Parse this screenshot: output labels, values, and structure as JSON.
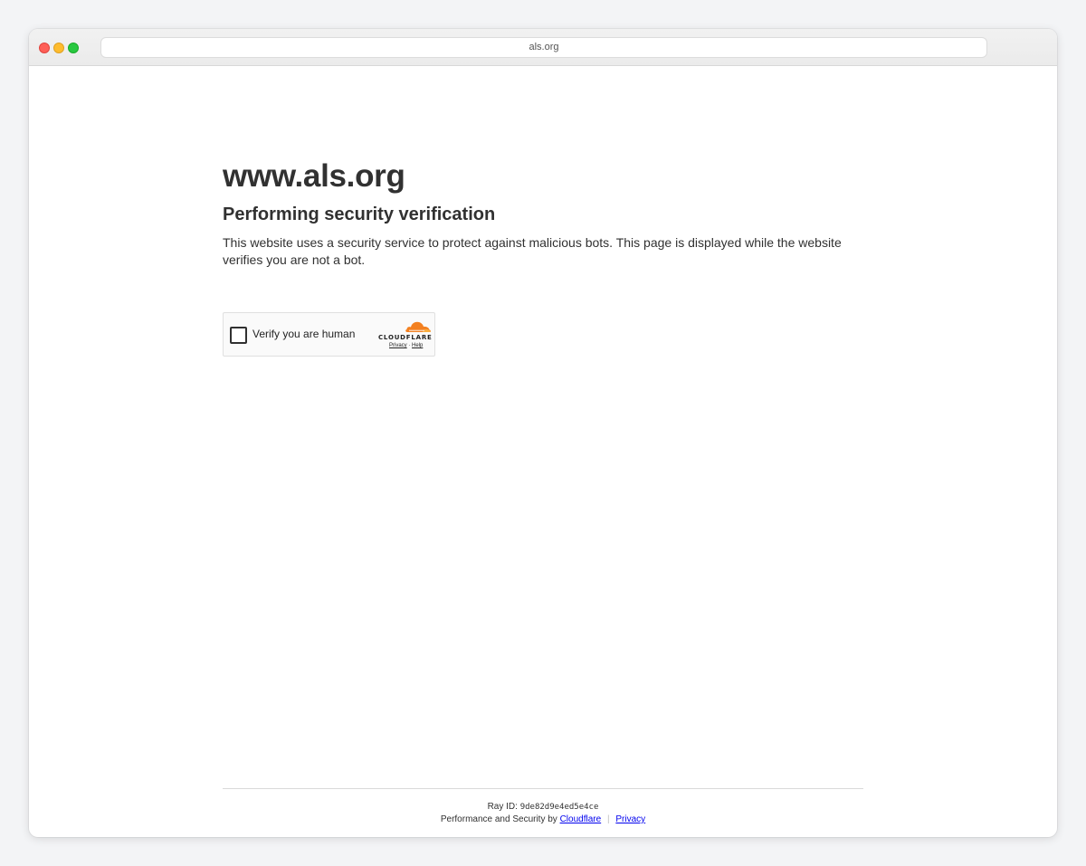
{
  "browser": {
    "url": "als.org"
  },
  "page": {
    "site_title": "www.als.org",
    "heading": "Performing security verification",
    "description": "This website uses a security service to protect against malicious bots. This page is displayed while the website verifies you are not a bot."
  },
  "widget": {
    "checkbox_label": "Verify you are human",
    "brand": "CLOUDFLARE",
    "privacy_link": "Privacy",
    "link_separator": "·",
    "help_link": "Help",
    "brand_color": "#f38020"
  },
  "footer": {
    "ray_label": "Ray ID:",
    "ray_id": "9de82d9e4ed5e4ce",
    "performance_text": "Performance and Security by",
    "cloudflare_link": "Cloudflare",
    "separator": "|",
    "privacy_link": "Privacy"
  }
}
